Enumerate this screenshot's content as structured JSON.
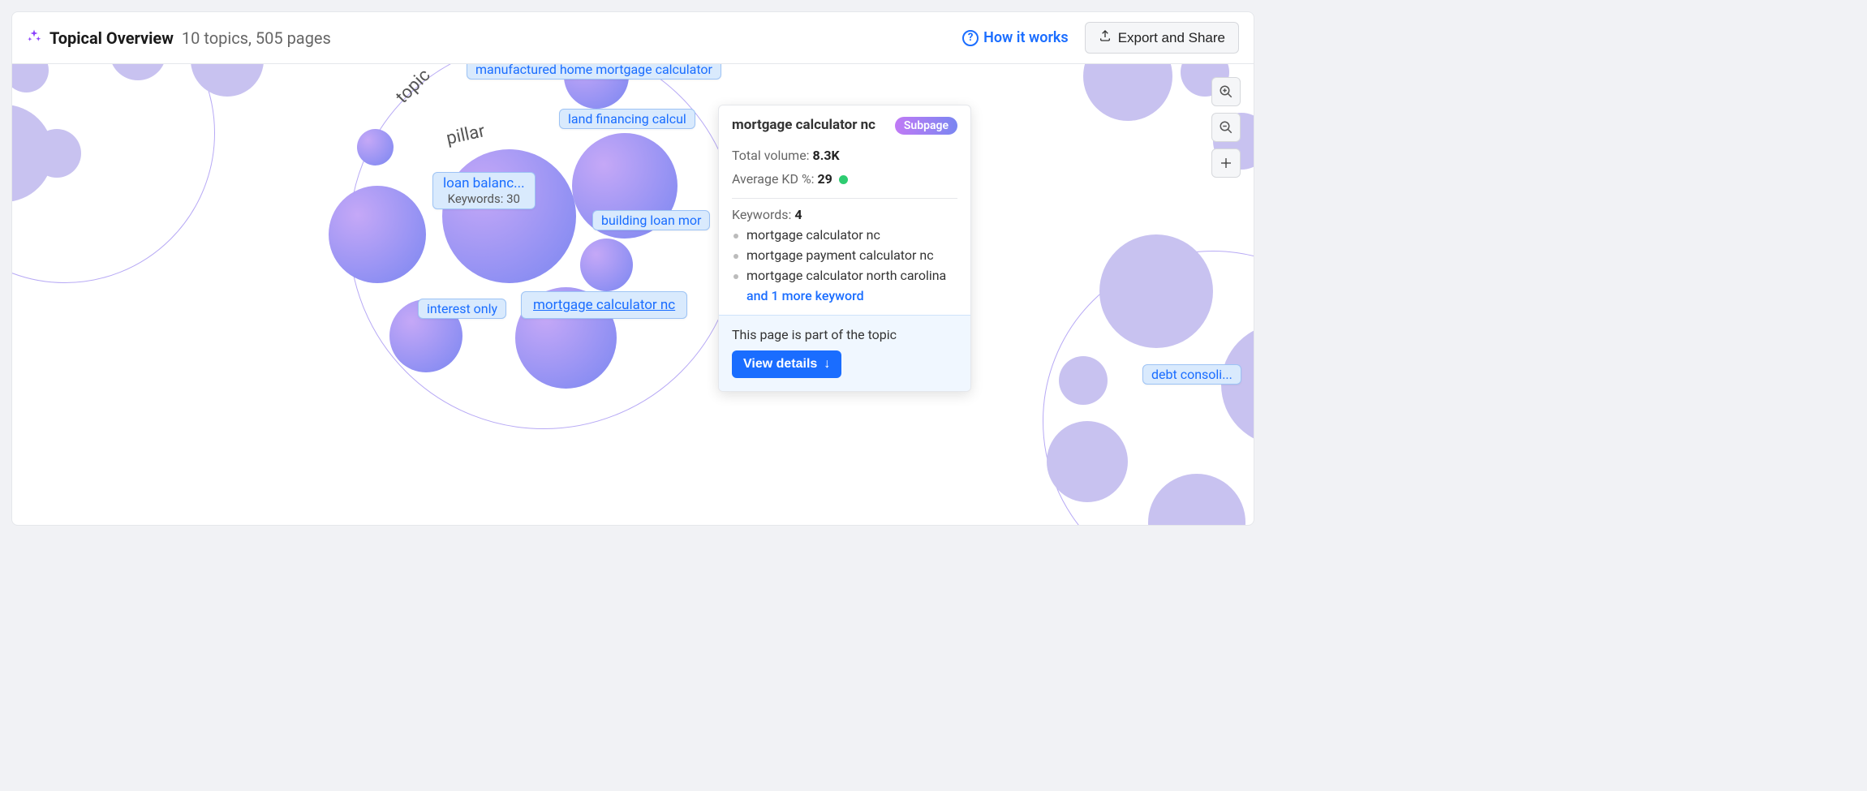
{
  "header": {
    "title": "Topical Overview",
    "subtitle": "10 topics, 505 pages",
    "how_link": "How it works",
    "export_label": "Export and Share"
  },
  "annotations": {
    "topic": "topic",
    "pillar": "pillar"
  },
  "nodes": {
    "manufactured": "manufactured home mortgage calculator",
    "land_financing": "land financing calcul",
    "loan_balanc_title": "loan balanc...",
    "loan_balanc_sub": "Keywords: 30",
    "building_loan": "building loan mor",
    "interest_only": "interest only",
    "mortgage_nc": "mortgage calculator nc",
    "debt_consoli": "debt consoli..."
  },
  "popover": {
    "title": "mortgage calculator nc",
    "badge": "Subpage",
    "total_volume_label": "Total volume:",
    "total_volume_value": "8.3K",
    "avg_kd_label": "Average KD %:",
    "avg_kd_value": "29",
    "keywords_label": "Keywords:",
    "keywords_count": "4",
    "keywords": [
      "mortgage calculator nc",
      "mortgage payment calculator nc",
      "mortgage calculator north carolina"
    ],
    "more_keywords": "and 1 more keyword",
    "footer_text": "This page is part of the topic",
    "details_label": "View details"
  },
  "icons": {
    "sparkle": "sparkle-icon",
    "help": "help-circle-icon",
    "export": "export-icon",
    "zoom_in": "zoom-in-icon",
    "zoom_out": "zoom-out-icon",
    "fit": "fit-screen-icon",
    "arrow_down": "arrow-down-icon"
  }
}
